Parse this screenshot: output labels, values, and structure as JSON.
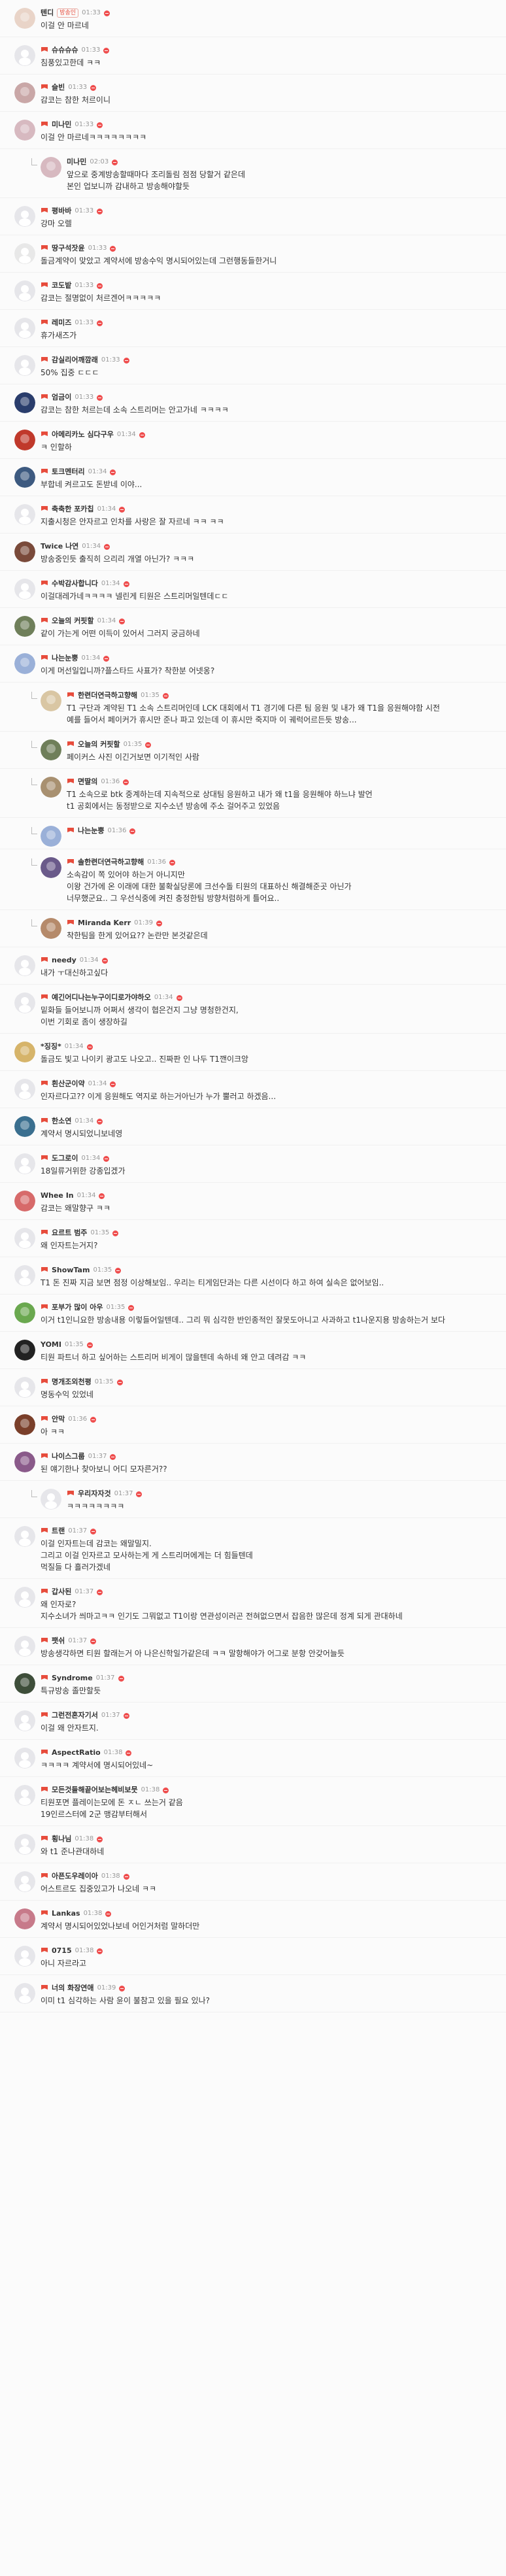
{
  "comments": [
    {
      "nick": "텐디",
      "tag": "방송인",
      "time": "01:33",
      "text": "이걸 안 마르네",
      "av": "#e9d4c8",
      "badge": "none",
      "reply": false
    },
    {
      "nick": "슈슈슈슈",
      "time": "01:33",
      "text": "침풍있고한데 ㅋㅋ",
      "av": "#e6e6ea",
      "badge": "flag",
      "reply": false
    },
    {
      "nick": "슬빈",
      "time": "01:33",
      "text": "감코는 참한 처르이니",
      "av": "#c9a7a7",
      "badge": "flag",
      "reply": false
    },
    {
      "nick": "미나민",
      "time": "01:33",
      "text": "이걸 안 마르네ㅋㅋㅋㅋㅋㅋㅋㅋ",
      "av": "#d7b9c0",
      "badge": "flag",
      "reply": false
    },
    {
      "nick": "미나민",
      "time": "02:03",
      "text": "앞으로 중계방송할때마다 조리돌림 점점 당할거 같은데\n본인 업보니까 감내하고 방송해야할듯",
      "av": "#d7b9c0",
      "badge": "none",
      "reply": true
    },
    {
      "nick": "평바바",
      "time": "01:33",
      "text": "강마 오렐",
      "av": "#e6e6ea",
      "badge": "flag",
      "reply": false
    },
    {
      "nick": "땅구석잣윤",
      "time": "01:33",
      "text": "돌금계약이 맞았고 계약서에 방송수익 명시되어있는데 그런행동들한거니",
      "av": "#e8e8e8",
      "badge": "flag",
      "reply": false
    },
    {
      "nick": "코도밭",
      "time": "01:33",
      "text": "감코는 절명없이 처르겐어ㅋㅋㅋㅋㅋ",
      "av": "#e6e6ea",
      "badge": "flag",
      "reply": false
    },
    {
      "nick": "레미즈",
      "time": "01:33",
      "text": "휴가새즈가",
      "av": "#e6e6ea",
      "badge": "flag",
      "reply": false
    },
    {
      "nick": "감실리어깨깜래",
      "time": "01:33",
      "text": "50% 집중 ㄷㄷㄷ",
      "av": "#e6e6ea",
      "badge": "flag",
      "reply": false
    },
    {
      "nick": "엄금이",
      "time": "01:33",
      "text": "감코는 참한 처르는데 소속 스트리머는 안고가네 ㅋㅋㅋㅋ",
      "av": "#2a3d6c",
      "badge": "flag",
      "reply": false
    },
    {
      "nick": "아메리카노 심다구우",
      "time": "01:34",
      "text": "ㅋ 인할하",
      "av": "#c0392b",
      "badge": "flag",
      "reply": false
    },
    {
      "nick": "토크멘터리",
      "time": "01:34",
      "text": "부합네 켜르고도 돈받네 이야...",
      "av": "#3d5a80",
      "badge": "flag",
      "reply": false
    },
    {
      "nick": "축축한 포카칩",
      "time": "01:34",
      "text": "지출시청은 안자르고 인차를 사랑은 잘 자르네 ㅋㅋ ㅋㅋ",
      "av": "#e6e6ea",
      "badge": "flag",
      "reply": false
    },
    {
      "nick": "Twice 나연",
      "time": "01:34",
      "text": "방송중인듯 출직히 으리리 개열 아닌가? ㅋㅋㅋ",
      "av": "#7a4a3a",
      "badge": "none",
      "reply": false
    },
    {
      "nick": "수박감사합니다",
      "time": "01:34",
      "text": "이걸대레가네ㅋㅋㅋㅋ 넬린게 티원은 스트리머일텐데ㄷㄷ",
      "av": "#e6e6ea",
      "badge": "flag",
      "reply": false
    },
    {
      "nick": "오늘의 커핏할",
      "time": "01:34",
      "text": "같이 가는게 어떤 이득이 있어서 그러지 궁금하네",
      "av": "#6f7f5a",
      "badge": "flag",
      "reply": false
    },
    {
      "nick": "나는눈뿡",
      "time": "01:34",
      "text": "이게 머선일입니까?플스타드 사표가? 착한분 어넷옹?",
      "av": "#9ab0d8",
      "badge": "flag",
      "reply": false
    },
    {
      "nick": "한련더연극하고향해",
      "time": "01:35",
      "text": "T1 구단과 계약된 T1 소속 스트리머인데 LCK 대회에서 T1 경기에 다른 팀 응원 및 내가 왜 T1을 응원해야함 시전\n예를 들어서 페이커가 휴시만 준나 파고 있는데 이 휴시만 죽지마 이 궤럭어르든듯 방송...",
      "av": "#d9c6a3",
      "badge": "flag",
      "reply": true
    },
    {
      "nick": "오늘의 커핏할",
      "time": "01:35",
      "text": "페이커스 사진 이긴거보면 이기적인 사람",
      "av": "#6f7f5a",
      "badge": "flag",
      "reply": true
    },
    {
      "nick": "면딸의",
      "time": "01:36",
      "text": "T1 소속으로 btk 중계하는데 지속적으로 상대팀 응원하고 내가 왜 t1을 응원해야 하느냐 발언\nt1 공회에서는 동정받으로 지수소년 방송에 주소 걸어주고 있었음",
      "av": "#a89070",
      "badge": "flag",
      "reply": true
    },
    {
      "nick": "나는눈뿡",
      "time": "01:36",
      "text": "",
      "av": "#9ab0d8",
      "badge": "flag",
      "reply": true
    },
    {
      "nick": "솔한련더연극하고향해",
      "time": "01:36",
      "text": "소속감이 쪽 있어야 하는거 아니지만\n이왕 건가에 온 이래에 대한 불확실당론에 크선수돌 티원의 대표하신 해결해준곳 아닌가\n너무했군요.. 그 우선식중에 켜진 충정한팀 방향처럼하게 틀어요..",
      "av": "#6a5a8a",
      "badge": "flag",
      "reply": true
    },
    {
      "nick": "Miranda Kerr",
      "time": "01:39",
      "text": "착한팀을 한게 있어요?? 논란만 본것같은데",
      "av": "#b58a6a",
      "badge": "flag",
      "reply": true
    },
    {
      "nick": "needy",
      "time": "01:34",
      "text": "내가 ㅜ대신하고싶다",
      "av": "#e6e6ea",
      "badge": "flag",
      "reply": false
    },
    {
      "nick": "예긴어디나는누구이디로가야하오",
      "time": "01:34",
      "text": "밑화들 들어보니까 어쩌서 생각이 협은건지 그냥 명청한건지,\n이번 기회로 좀이 생장하길",
      "av": "#e6e6ea",
      "badge": "flag",
      "reply": false
    },
    {
      "nick": "*징징*",
      "time": "01:34",
      "text": "돌금도 빛고 나이키 광고도 나오고.. 진짜판 인 나두 T1깬이크앙",
      "av": "#d6b46a",
      "badge": "none",
      "reply": false
    },
    {
      "nick": "흰산군이약",
      "time": "01:34",
      "text": "인자르다고?? 이게 응원해도 역지로 하는거아닌가 누가 뿔러고 하겠음...",
      "av": "#e6e6ea",
      "badge": "flag",
      "reply": false
    },
    {
      "nick": "한소연",
      "time": "01:34",
      "text": "계약서 명시되었니보네영",
      "av": "#3a6f8f",
      "badge": "flag",
      "reply": false
    },
    {
      "nick": "도그로이",
      "time": "01:34",
      "text": "18일류거위한 강종입겠가",
      "av": "#e6e6ea",
      "badge": "flag",
      "reply": false
    },
    {
      "nick": "Whee In",
      "time": "01:34",
      "text": "감코는 왜말향구 ㅋㅋ",
      "av": "#d76a6a",
      "badge": "none",
      "reply": false
    },
    {
      "nick": "요르트 범주",
      "time": "01:35",
      "text": "왜 인자트는거지?",
      "av": "#e6e6ea",
      "badge": "flag",
      "reply": false
    },
    {
      "nick": "ShowTam",
      "time": "01:35",
      "text": "T1 돈 진짜 지금 보면 점정 이상해보임.. 우리는 티게임단과는 다른 시선이다 하고 하여 실속은 없어보임..",
      "av": "#e6e6ea",
      "badge": "flag",
      "reply": false
    },
    {
      "nick": "포부가 많이 아우",
      "time": "01:35",
      "text": "이거 t1인니요한 방송내용 이렇들어일텐데.. 그리 뭐 심각한 반인종적인 잘못도아니고 사과하고 t1나운지용 방송하는거 보다",
      "av": "#6aa84f",
      "badge": "flag",
      "reply": false
    },
    {
      "nick": "YOMI",
      "time": "01:35",
      "text": "티원 파트너 하고 싶어하는 스트리머 비게이 많을텐데 속하네 왜 안고 데려감 ㅋㅋ",
      "av": "#222222",
      "badge": "none",
      "reply": false
    },
    {
      "nick": "명개조외천평",
      "time": "01:35",
      "text": "명동수익 있었네",
      "av": "#e6e6ea",
      "badge": "flag",
      "reply": false
    },
    {
      "nick": "안막",
      "time": "01:36",
      "text": "아 ㅋㅋ",
      "av": "#7a3f2a",
      "badge": "flag",
      "reply": false
    },
    {
      "nick": "나이스그룹",
      "time": "01:37",
      "text": "된 얘기한나 찾아보니 어디 모자른거??",
      "av": "#8a5a8a",
      "badge": "flag",
      "reply": false
    },
    {
      "nick": "우리자자것",
      "time": "01:37",
      "text": "ㅋㅋㅋㅋㅋㅋㅋㅋ",
      "av": "#e6e6ea",
      "badge": "flag",
      "reply": true
    },
    {
      "nick": "트랜",
      "time": "01:37",
      "text": "이걸 인자트는데 감코는 왜말밀지.\n그리고 이걸 인자르고 모사하는게 게 스트리머에게는 더 힘들텐데\n먹질들 다 흘러가겠네",
      "av": "#e6e6ea",
      "badge": "flag",
      "reply": false
    },
    {
      "nick": "갑사된",
      "time": "01:37",
      "text": "왜 인자로?\n지수소녀가 씌마고ㅋㅋ 인기도 그뭐없고 T1이랑 연관성이러곤 전혀없으면서 잡음한 많은데 정계 되게 관대하네",
      "av": "#e6e6ea",
      "badge": "flag",
      "reply": false
    },
    {
      "nick": "팻쉬",
      "time": "01:37",
      "text": "방송생각하면 티원 할래는거 아 나은신학일가같은데 ㅋㅋ 말항해야가 어그로 분항 안갖어늘듯",
      "av": "#e6e6ea",
      "badge": "flag",
      "reply": false
    },
    {
      "nick": "Syndrome",
      "time": "01:37",
      "text": "특규방송 졸만할듯",
      "av": "#3e4e3a",
      "badge": "flag",
      "reply": false
    },
    {
      "nick": "그런전혼자기서",
      "time": "01:37",
      "text": "이걸 왜 안자트지.",
      "av": "#e6e6ea",
      "badge": "flag",
      "reply": false
    },
    {
      "nick": "AspectRatio",
      "time": "01:38",
      "text": "ㅋㅋㅋㅋ 계약서에 명시되어있네~",
      "av": "#e6e6ea",
      "badge": "flag",
      "reply": false
    },
    {
      "nick": "모든것들해끝어보는헤비보뭇",
      "time": "01:38",
      "text": "티원포면 플레이는모에 돈 ㅈㄴ 쓰는거 같음\n19인르스터에 2군 맹감부터해서",
      "av": "#e6e6ea",
      "badge": "flag",
      "reply": false
    },
    {
      "nick": "횡나님",
      "time": "01:38",
      "text": "와 t1 준나관대하네",
      "av": "#e6e6ea",
      "badge": "flag",
      "reply": false
    },
    {
      "nick": "아픈도우레이아",
      "time": "01:38",
      "text": "어스트르도 집중있고가 나오네 ㅋㅋ",
      "av": "#e6e6ea",
      "badge": "flag",
      "reply": false
    },
    {
      "nick": "Lankas",
      "time": "01:38",
      "text": "계약서 명시되어있었나보네 어인거처럼 말하더만",
      "av": "#c77a8a",
      "badge": "flag",
      "reply": false
    },
    {
      "nick": "0715",
      "time": "01:38",
      "text": "아니 자르라고",
      "av": "#e6e6ea",
      "badge": "flag",
      "reply": false
    },
    {
      "nick": "너의 화장연애",
      "time": "01:39",
      "text": "이미 t1 심각하는 사람 윤이 불참고 있을 필요 있나?",
      "av": "#e6e6ea",
      "badge": "flag",
      "reply": false
    }
  ]
}
